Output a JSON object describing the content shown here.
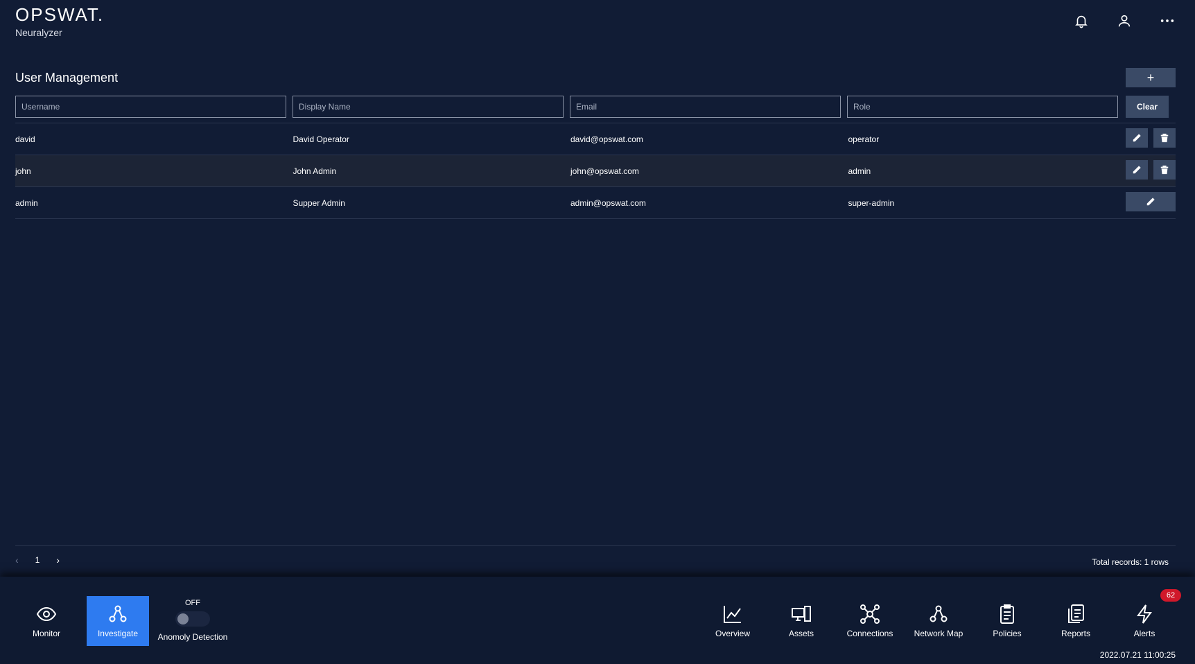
{
  "brand": {
    "name": "OPSWAT.",
    "product": "Neuralyzer"
  },
  "header_icons": [
    "bell-icon",
    "user-icon",
    "more-icon"
  ],
  "page": {
    "title": "User Management",
    "add_label": "+",
    "clear_label": "Clear"
  },
  "filters": {
    "username_placeholder": "Username",
    "display_name_placeholder": "Display Name",
    "email_placeholder": "Email",
    "role_placeholder": "Role"
  },
  "users": [
    {
      "username": "david",
      "display_name": "David Operator",
      "email": "david@opswat.com",
      "role": "operator",
      "actions": [
        "edit",
        "delete"
      ]
    },
    {
      "username": "john",
      "display_name": "John Admin",
      "email": "john@opswat.com",
      "role": "admin",
      "actions": [
        "edit",
        "delete"
      ]
    },
    {
      "username": "admin",
      "display_name": "Supper Admin",
      "email": "admin@opswat.com",
      "role": "super-admin",
      "actions": [
        "edit"
      ]
    }
  ],
  "pagination": {
    "prev": "‹",
    "current_page": "1",
    "next": "›",
    "total": "Total records: 1 rows"
  },
  "bottom_nav": {
    "monitor": "Monitor",
    "investigate": "Investigate",
    "anomaly_state": "OFF",
    "anomaly_label": "Anomoly Detection",
    "overview": "Overview",
    "assets": "Assets",
    "connections": "Connections",
    "network_map": "Network Map",
    "policies": "Policies",
    "reports": "Reports",
    "alerts": "Alerts",
    "alerts_count": "62"
  },
  "timestamp": "2022.07.21 11:00:25",
  "colors": {
    "background": "#111c35",
    "button": "#3a4a66",
    "active": "#2e7bf0",
    "badge": "#d0182a"
  }
}
